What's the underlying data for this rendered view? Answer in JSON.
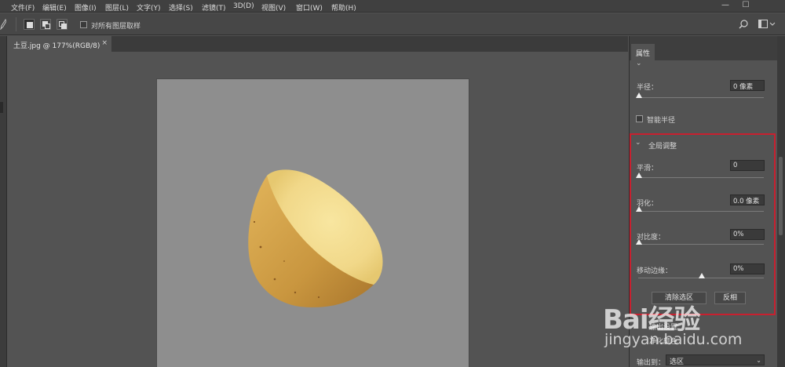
{
  "menu": [
    "文件(F)",
    "编辑(E)",
    "图像(I)",
    "图层(L)",
    "文字(Y)",
    "选择(S)",
    "滤镜(T)",
    "3D(D)",
    "视图(V)",
    "窗口(W)",
    "帮助(H)"
  ],
  "window_controls": {
    "minimize": "—",
    "maximize": "☐"
  },
  "options_bar": {
    "sample_all_layers_label": "对所有图层取样"
  },
  "document_tab": {
    "label": "土豆.jpg @ 177%(RGB/8)",
    "close": "×"
  },
  "panel": {
    "tab_label": "属性",
    "radius": {
      "label": "半径：",
      "value": "0 像素",
      "slider_pct": 0
    },
    "smart_radius_label": "智能半径",
    "global_refine": {
      "header": "全局调整",
      "smooth": {
        "label": "平滑：",
        "value": "0",
        "slider_pct": 0
      },
      "feather": {
        "label": "羽化：",
        "value": "0.0 像素",
        "slider_pct": 0
      },
      "contrast": {
        "label": "对比度：",
        "value": "0%",
        "slider_pct": 0
      },
      "shift_edge": {
        "label": "移动边缘：",
        "value": "0%",
        "slider_pct": 50
      }
    },
    "clear_selection_label": "清除选区",
    "invert_label": "反相",
    "output_settings_label": "输出设置",
    "decontaminate_label": "净化颜色",
    "output_to_label": "输出到：",
    "output_to_value": "选区"
  },
  "watermark": {
    "logo": "Bai经验",
    "url": "jingyan.baidu.com"
  },
  "colors": {
    "accent_red": "#c8202f",
    "potato_flesh": "#f4dd8d",
    "potato_skin": "#d1a34a"
  }
}
